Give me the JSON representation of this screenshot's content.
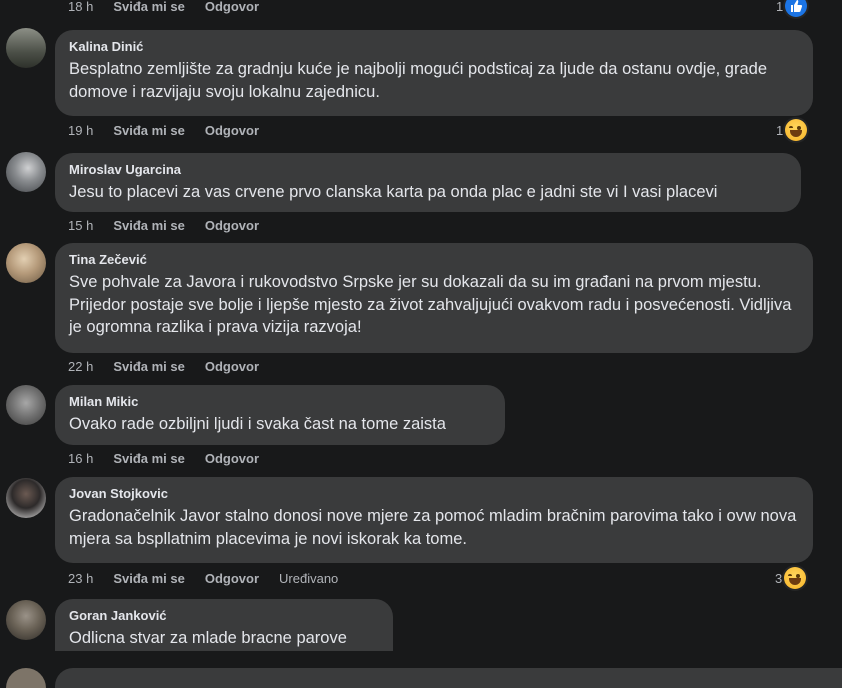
{
  "labels": {
    "like": "Sviđa mi se",
    "reply": "Odgovor"
  },
  "top": {
    "time": "18 h",
    "reactions": "1",
    "reaction_icon": "like-icon"
  },
  "comments": [
    {
      "author": "Kalina Dinić",
      "text": "Besplatno zemljište za gradnju kuće je najbolji mogući podsticaj za ljude da ostanu ovdje, grade domove i razvijaju svoju lokalnu zajednicu.",
      "time": "19 h",
      "reactions": "1",
      "reaction_icon": "laugh-icon",
      "avatar_color": "#6b6f63"
    },
    {
      "author": "Miroslav Ugarcina",
      "text": "Jesu to placevi za vas crvene prvo clanska karta pa onda plac e jadni ste vi I vasi placevi",
      "time": "15 h",
      "avatar_color": "#8a8d90"
    },
    {
      "author": "Tina Zečević",
      "text": "Sve pohvale za Javora i rukovodstvo Srpske jer su dokazali da su im građani na prvom mjestu. Prijedor postaje sve bolje i ljepše mjesto za život zahvaljujući ovakvom radu i posvećenosti. Vidljiva je ogromna razlika i prava vizija razvoja!",
      "time": "22 h",
      "avatar_color": "#b59a7a"
    },
    {
      "author": "Milan Mikic",
      "text": "Ovako rade ozbiljni ljudi i svaka čast na tome zaista",
      "time": "16 h",
      "avatar_color": "#7a7a7a"
    },
    {
      "author": "Jovan Stojkovic",
      "text": "Gradonačelnik Javor stalno donosi nove mjere za pomoć mladim bračnim parovima tako i ovw nova mjera sa bspllatnim placevima je novi iskorak ka tome.",
      "time": "23 h",
      "edited": "Uređivano",
      "reactions": "3",
      "reaction_icon": "laugh-icon",
      "avatar_color": "#2d2a2a"
    },
    {
      "author": "Goran Janković",
      "text": "Odlicna stvar za mlade bracne parove",
      "avatar_color": "#6a6256"
    }
  ]
}
